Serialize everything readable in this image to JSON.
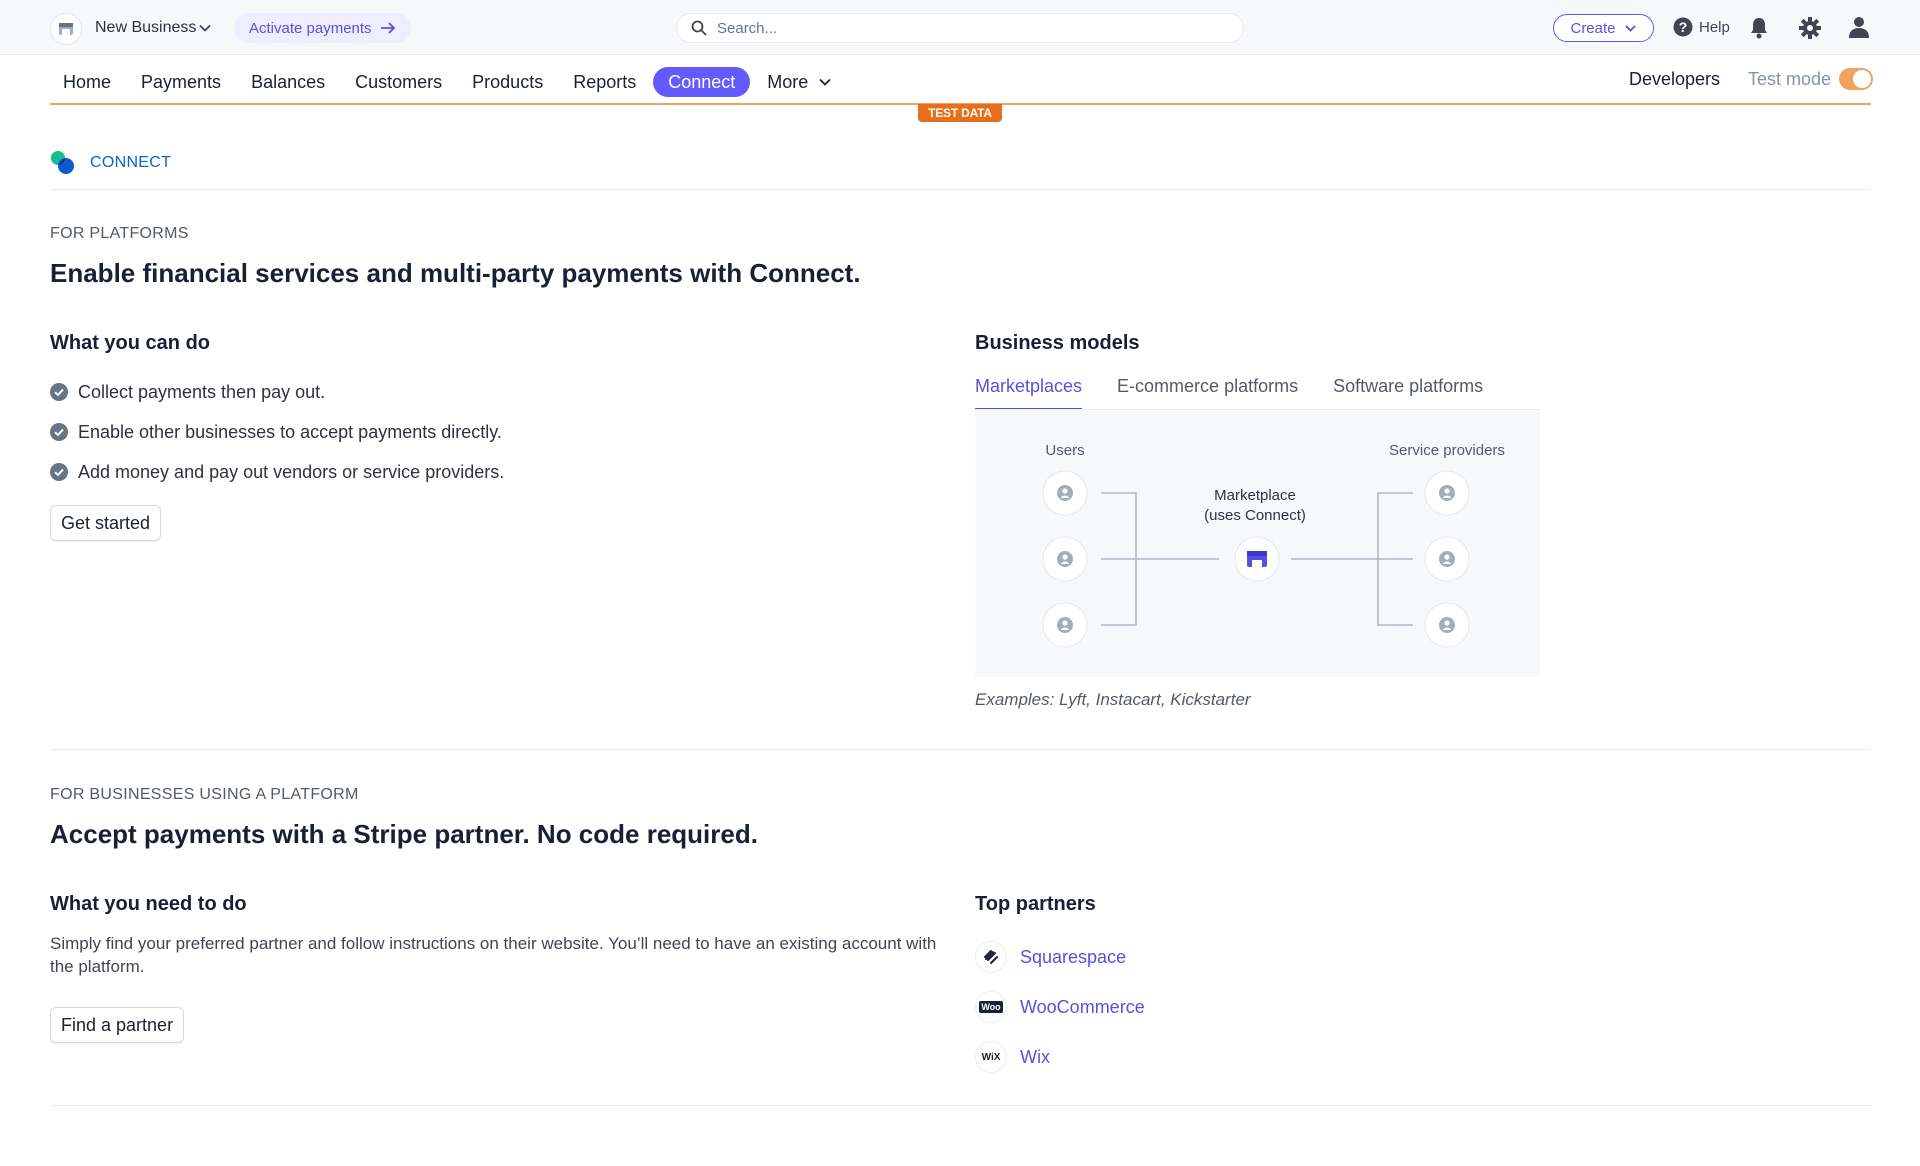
{
  "header": {
    "business_name": "New Business",
    "activate_label": "Activate payments",
    "search_placeholder": "Search...",
    "create_label": "Create",
    "help_label": "Help"
  },
  "nav": {
    "items": [
      "Home",
      "Payments",
      "Balances",
      "Customers",
      "Products",
      "Reports",
      "Connect",
      "More"
    ],
    "active": "Connect",
    "developers_label": "Developers",
    "test_mode_label": "Test mode",
    "test_mode_on": true,
    "test_badge": "TEST DATA"
  },
  "connect": {
    "label": "CONNECT"
  },
  "platforms": {
    "eyebrow": "FOR PLATFORMS",
    "headline": "Enable financial services and multi-party payments with Connect.",
    "can_do_title": "What you can do",
    "can_do_items": [
      "Collect payments then pay out.",
      "Enable other businesses to accept payments directly.",
      "Add money and pay out vendors or service providers."
    ],
    "get_started_label": "Get started",
    "business_models_title": "Business models",
    "tabs": [
      "Marketplaces",
      "E-commerce platforms",
      "Software platforms"
    ],
    "active_tab": "Marketplaces",
    "diagram": {
      "left_label": "Users",
      "right_label": "Service providers",
      "center_line1": "Marketplace",
      "center_line2": "(uses Connect)"
    },
    "examples": "Examples: Lyft, Instacart, Kickstarter"
  },
  "businesses": {
    "eyebrow": "FOR BUSINESSES USING A PLATFORM",
    "headline": "Accept payments with a Stripe partner. No code required.",
    "need_to_do_title": "What you need to do",
    "need_to_do_text": "Simply find your preferred partner and follow instructions on their website. You’ll need to have an existing account with the platform.",
    "find_partner_label": "Find a partner",
    "top_partners_title": "Top partners",
    "partners": [
      {
        "name": "Squarespace",
        "logo": "squarespace-logo"
      },
      {
        "name": "WooCommerce",
        "logo": "woocommerce-logo",
        "logo_text": "Woo"
      },
      {
        "name": "Wix",
        "logo": "wix-logo",
        "logo_text": "WiX"
      }
    ]
  },
  "colors": {
    "accent": "#635bff",
    "link": "#5851df",
    "test_mode": "#e56f1a",
    "connect_blue": "#0a66c2"
  }
}
